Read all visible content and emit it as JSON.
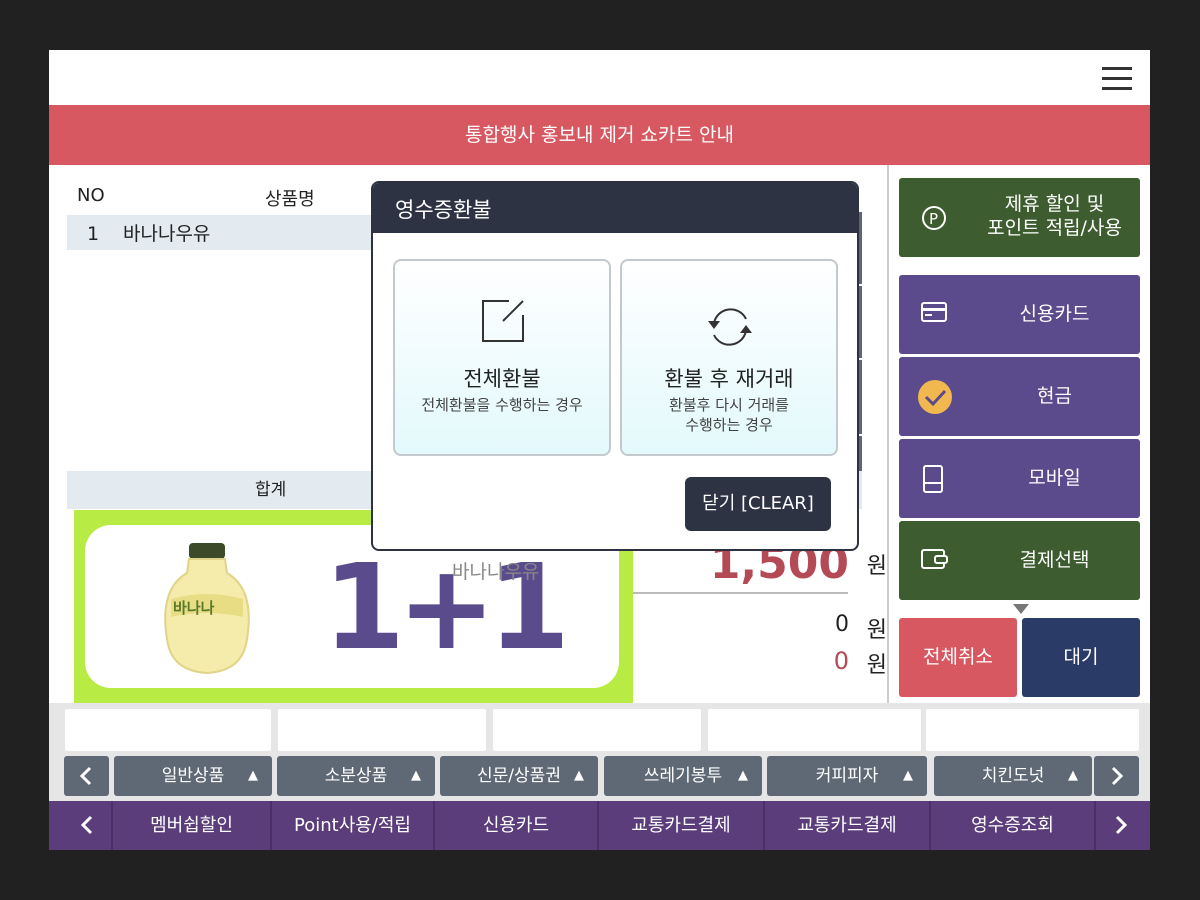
{
  "banner": {
    "text": "통합행사 홍보내 제거 쇼카트 안내"
  },
  "table": {
    "headers": {
      "no": "NO",
      "name": "상품명"
    },
    "rows": [
      {
        "no": "1",
        "name": "바나나우유"
      }
    ],
    "sum_label": "합계"
  },
  "promo": {
    "badge": "1+1",
    "product": "바나나우유",
    "bottle_text": "바나나"
  },
  "totals": {
    "amount": "1,500",
    "amount_unit": "원",
    "line2": "0",
    "line2_unit": "원",
    "line3": "0",
    "line3_unit": "원"
  },
  "payment": {
    "affiliate_line1": "제휴 할인 및",
    "affiliate_line2": "포인트 적립/사용",
    "credit_card": "신용카드",
    "cash": "현금",
    "mobile": "모바일",
    "select": "결제선택",
    "cancel_all": "전체취소",
    "wait": "대기"
  },
  "categories": [
    "일반상품",
    "소분상품",
    "신문/상품권",
    "쓰레기봉투",
    "커피피자",
    "치킨도넛"
  ],
  "bottom_menu": [
    "멤버쉽할인",
    "Point사용/적립",
    "신용카드",
    "교통카드결제",
    "교통카드결제",
    "영수증조회"
  ],
  "modal": {
    "title": "영수증환불",
    "full_refund_title": "전체환불",
    "full_refund_sub": "전체환불을 수행하는 경우",
    "retrade_title": "환불 후 재거래",
    "retrade_sub1": "환불후 다시 거래를",
    "retrade_sub2": "수행하는 경우",
    "close": "닫기 [CLEAR]"
  },
  "colors": {
    "banner": "#d85862",
    "green": "#3d5c2f",
    "purple": "#5b4a8c",
    "navy": "#2a3b68",
    "promo": "#b8ec45",
    "modal_header": "#2e3344"
  }
}
